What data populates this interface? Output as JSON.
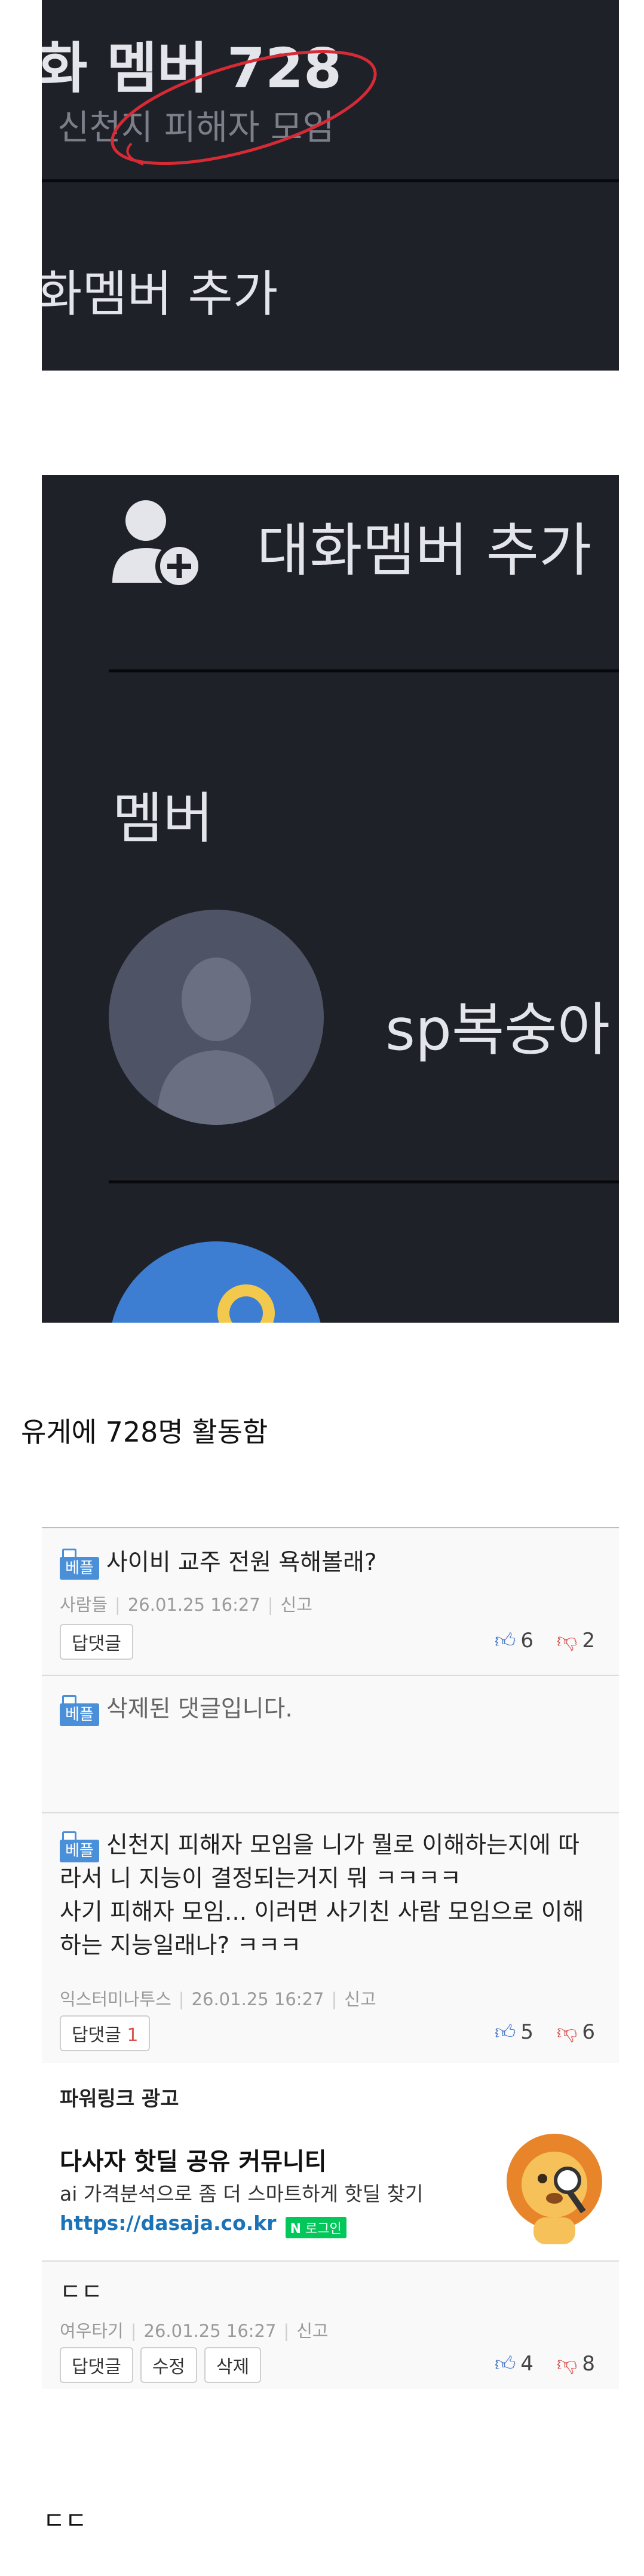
{
  "screenshot1": {
    "title_fragment": "화 멤버 728",
    "subtitle_fragment": "신천지 피해자 모임",
    "add_member_fragment": "화멤버 추가"
  },
  "screenshot2": {
    "add_member_label": "대화멤버 추가",
    "members_heading": "멤버",
    "member1_name": "sp복숭아"
  },
  "caption_top": "유게에 728명 활동함",
  "comments": [
    {
      "badge": "베플",
      "text": "사이비 교주 전원 욕해볼래?",
      "author": "사람들",
      "date": "26.01.25",
      "time": "16:27",
      "report": "신고",
      "reply_label": "답댓글",
      "up": "6",
      "down": "2"
    },
    {
      "badge": "베플",
      "text": "삭제된 댓글입니다."
    },
    {
      "badge": "베플",
      "text_lines": [
        "신천지 피해자 모임을 니가 뭘로 이해하는지에 따",
        "라서 니 지능이 결정되는거지 뭐 ㅋㅋㅋㅋ",
        "사기 피해자 모임... 이러면 사기친 사람 모임으로 이해",
        "하는 지능일래나? ㅋㅋㅋ"
      ],
      "author": "익스터미나투스",
      "date": "26.01.25",
      "time": "16:27",
      "report": "신고",
      "reply_label": "답댓글",
      "reply_count": "1",
      "up": "5",
      "down": "6"
    }
  ],
  "ad": {
    "header": "파워링크 광고",
    "title": "다사자 핫딜 공유 커뮤니티",
    "desc": "ai 가격분석으로 좀 더 스마트하게 핫딜 찾기",
    "url": "https://dasaja.co.kr",
    "login_badge": "로그인",
    "login_badge_icon": "N"
  },
  "my_comment": {
    "text": "ㄷㄷ",
    "author": "여우타기",
    "date": "26.01.25",
    "time": "16:27",
    "report": "신고",
    "reply_label": "답댓글",
    "edit_label": "수정",
    "delete_label": "삭제",
    "up": "4",
    "down": "8"
  },
  "caption_bottom": "ㄷㄷ",
  "colors": {
    "dark_bg": "#1f2129",
    "best_badge": "#4a90d9",
    "url": "#1a73b8",
    "naver_green": "#03c75a",
    "circle_annotation": "#d62a35"
  }
}
